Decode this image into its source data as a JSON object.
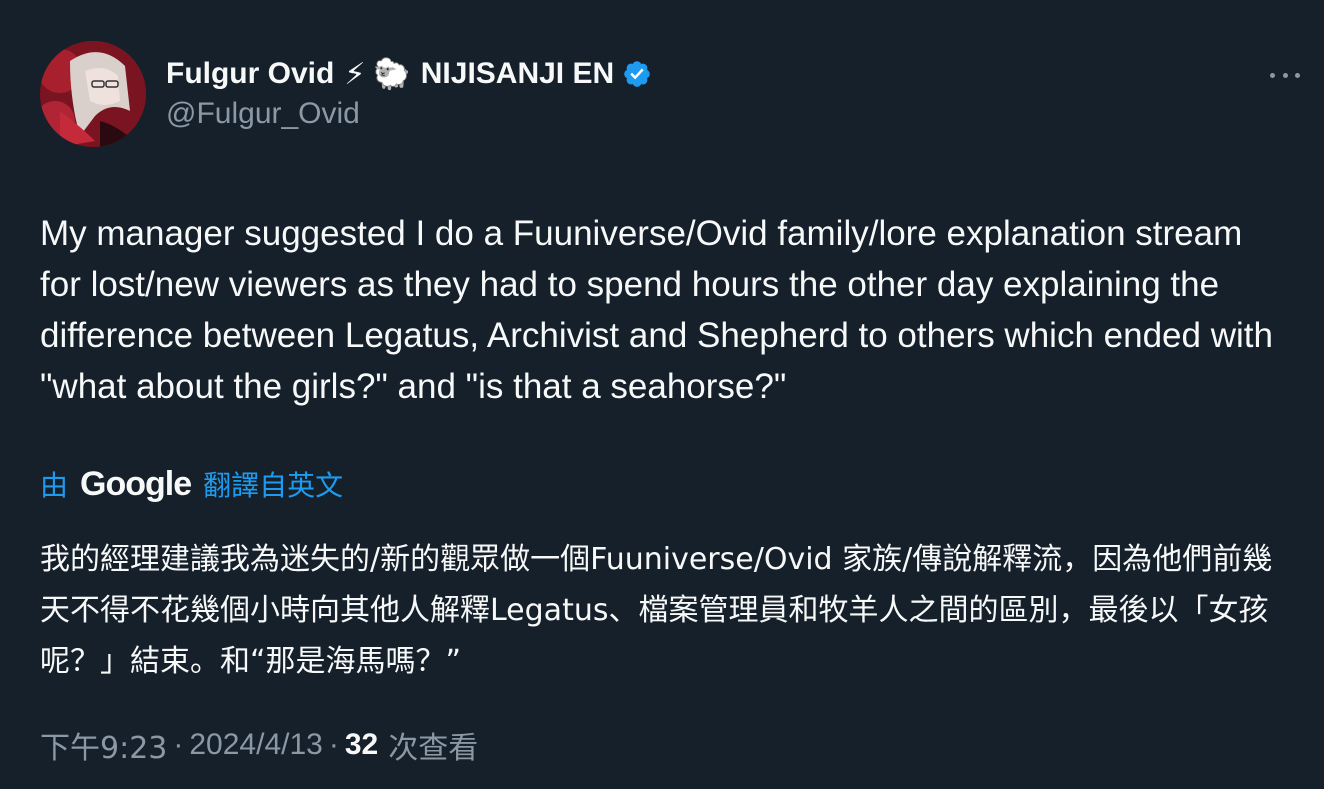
{
  "author": {
    "display_name": "Fulgur Ovid",
    "emoji_1": "⚡",
    "emoji_2": "🐑",
    "org": "NIJISANJI EN",
    "handle": "@Fulgur_Ovid",
    "verified": true,
    "avatar_icon": "avatar-image"
  },
  "more_icon": "more-horizontal-icon",
  "tweet": {
    "text": "My manager suggested I do a Fuuniverse/Ovid family/lore explanation stream for lost/new viewers as they had to spend hours the other day explaining the difference between Legatus, Archivist and Shepherd to others which ended with \"what about the girls?\" and \"is that a seahorse?\""
  },
  "translation": {
    "by_label": "由",
    "provider": "Google",
    "from_label": "翻譯自英文",
    "text": "我的經理建議我為迷失的/新的觀眾做一個Fuuniverse/Ovid 家族/傳說解釋流，因為他們前幾天不得不花幾個小時向其他人解釋Legatus、檔案管理員和牧羊人之間的區別，最後以「女孩呢？」結束。和“那是海馬嗎？”"
  },
  "meta": {
    "time": "下午9:23",
    "separator_1": "·",
    "date": "2024/4/13",
    "separator_2": "·",
    "views_count": "32",
    "views_label": "次查看"
  },
  "colors": {
    "background": "#15202b",
    "text_primary": "#f7f9f9",
    "text_secondary": "#8b98a5",
    "accent": "#1d9bf0"
  }
}
